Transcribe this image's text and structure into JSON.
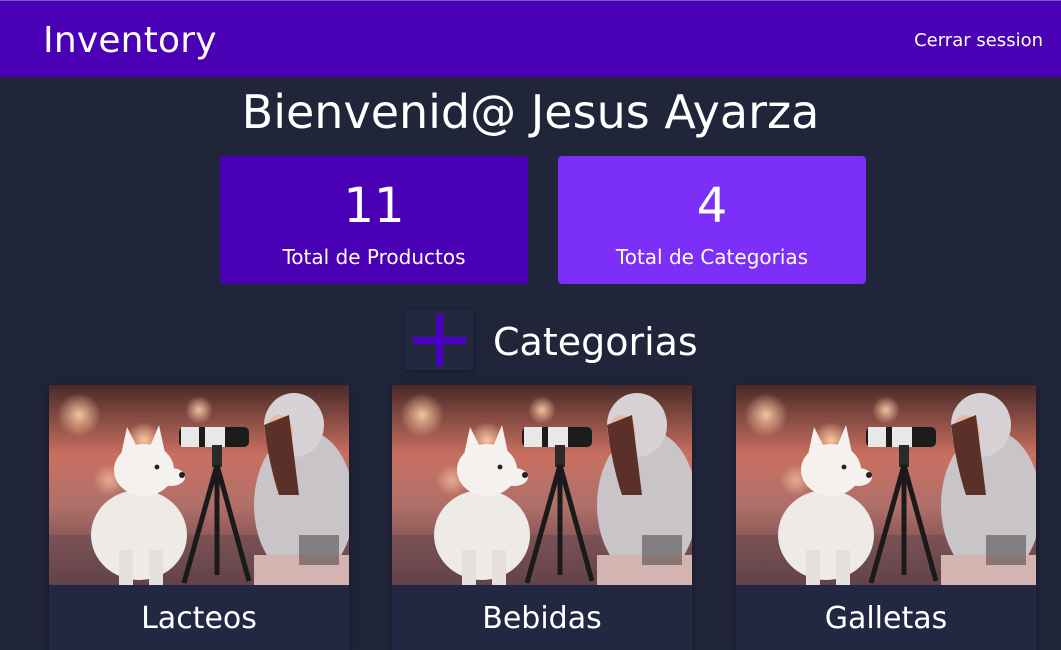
{
  "header": {
    "title": "Inventory",
    "logout_label": "Cerrar session"
  },
  "welcome": {
    "text": "Bienvenid@ Jesus Ayarza"
  },
  "stats": {
    "products": {
      "value": "11",
      "label": "Total de Productos",
      "color": "#4a00b4"
    },
    "categories": {
      "value": "4",
      "label": "Total de Categorias",
      "color": "#7b2ff7"
    }
  },
  "categories_section": {
    "title": "Categorias",
    "add_icon": "plus-icon",
    "items": [
      {
        "name": "Lacteos",
        "image": "girl-with-dog-and-camera-photo"
      },
      {
        "name": "Bebidas",
        "image": "girl-with-dog-and-camera-photo"
      },
      {
        "name": "Galletas",
        "image": "girl-with-dog-and-camera-photo"
      }
    ]
  },
  "colors": {
    "navbar": "#4a00b4",
    "background": "#20253a",
    "accent": "#7b2ff7",
    "plus_icon": "#4a00c8"
  }
}
